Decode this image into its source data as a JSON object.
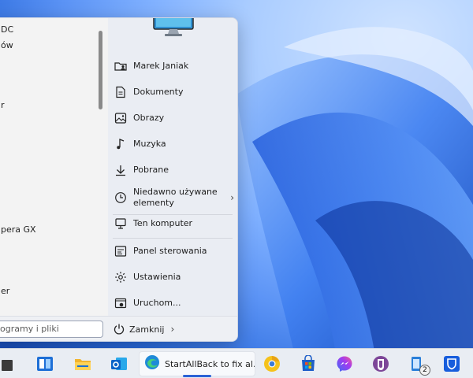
{
  "start_menu": {
    "left_items": [
      "DC",
      "ów",
      "r",
      "pera GX",
      "er"
    ],
    "right_items": [
      {
        "label": "Marek Janiak",
        "icon": "user-folder-icon"
      },
      {
        "label": "Dokumenty",
        "icon": "document-icon"
      },
      {
        "label": "Obrazy",
        "icon": "image-icon"
      },
      {
        "label": "Muzyka",
        "icon": "music-icon"
      },
      {
        "label": "Pobrane",
        "icon": "download-icon"
      },
      {
        "label": "Niedawno używane elementy",
        "line1": "Niedawno używane",
        "line2": "elementy",
        "icon": "clock-icon",
        "has_submenu": true
      },
      {
        "label": "Ten komputer",
        "icon": "computer-icon"
      },
      {
        "label": "Panel sterowania",
        "icon": "control-panel-icon"
      },
      {
        "label": "Ustawienia",
        "icon": "settings-icon"
      },
      {
        "label": "Uruchom...",
        "icon": "run-icon"
      }
    ],
    "search_placeholder": "ogramy i pliki",
    "shutdown_label": "Zamknij"
  },
  "taskbar": {
    "active_app_label": "StartAllBack to fix al...",
    "badge_count": "2",
    "accent": "#2a62d6"
  }
}
